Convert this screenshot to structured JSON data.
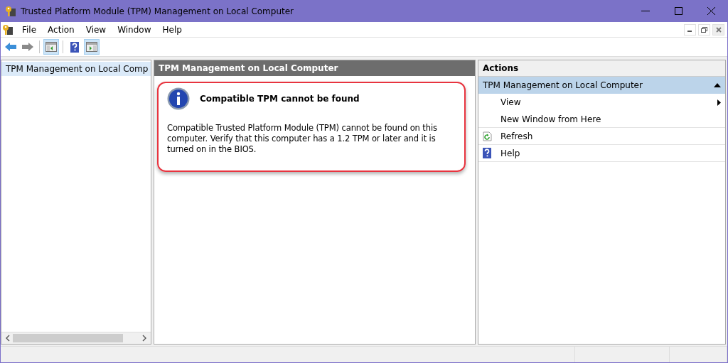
{
  "window": {
    "title": "Trusted Platform Module (TPM) Management on Local Computer"
  },
  "menu": [
    "File",
    "Action",
    "View",
    "Window",
    "Help"
  ],
  "toolbar": [
    {
      "kind": "back",
      "disabled": false
    },
    {
      "kind": "forward",
      "disabled": true
    },
    {
      "kind": "tree-pane",
      "pressed": true
    },
    {
      "kind": "help",
      "pressed": false
    },
    {
      "kind": "action-pane",
      "pressed": true
    }
  ],
  "tree": {
    "items": [
      {
        "label": "TPM Management on Local Comp",
        "selected": true
      }
    ]
  },
  "content": {
    "header": "TPM Management on Local Computer",
    "message": {
      "title": "Compatible TPM cannot be found",
      "body": "Compatible Trusted Platform Module (TPM) cannot be found on this computer. Verify that this computer has a 1.2 TPM or later and it is turned on in the BIOS."
    }
  },
  "actions": {
    "title": "Actions",
    "section": {
      "label": "TPM Management on Local Computer",
      "expanded": true
    },
    "items": [
      {
        "label": "View",
        "kind": "submenu"
      },
      {
        "label": "New Window from Here",
        "kind": "plain"
      },
      {
        "label": "Refresh",
        "kind": "refresh"
      },
      {
        "label": "Help",
        "kind": "help"
      }
    ]
  }
}
